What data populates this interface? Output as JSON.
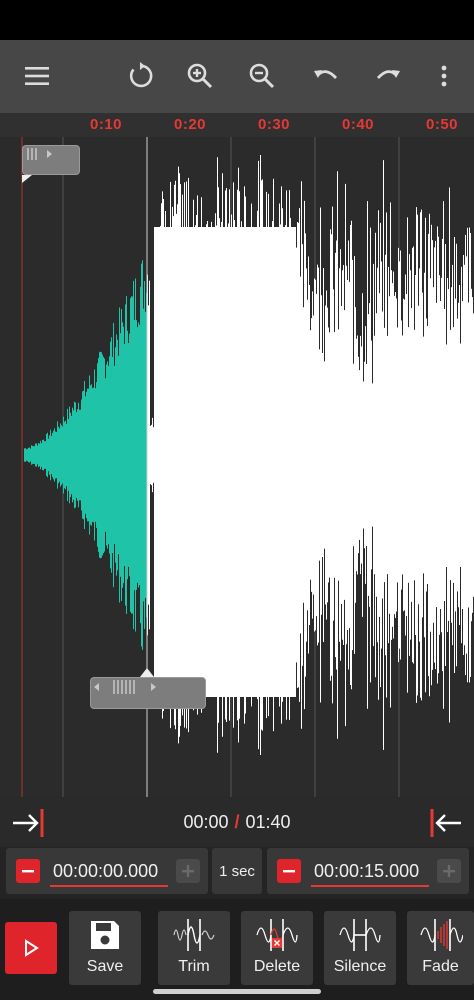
{
  "toolbar": {
    "icons": [
      "menu-icon",
      "refresh-icon",
      "zoom-in-icon",
      "zoom-out-icon",
      "undo-icon",
      "redo-icon",
      "more-vert-icon"
    ]
  },
  "ruler": {
    "ticks": [
      "0:10",
      "0:20",
      "0:30",
      "0:40",
      "0:50"
    ]
  },
  "playback": {
    "current": "00:00",
    "separator": "/",
    "total": "01:40"
  },
  "selection": {
    "start": "00:00:00.000",
    "step": "1 sec",
    "end": "00:00:15.000"
  },
  "actions": {
    "save": "Save",
    "trim": "Trim",
    "delete": "Delete",
    "silence": "Silence",
    "fade": "Fade"
  },
  "colors": {
    "accent": "#e53935",
    "selected_wave": "#1fc3a8",
    "wave": "#ffffff",
    "toolbar_bg": "#474747"
  }
}
